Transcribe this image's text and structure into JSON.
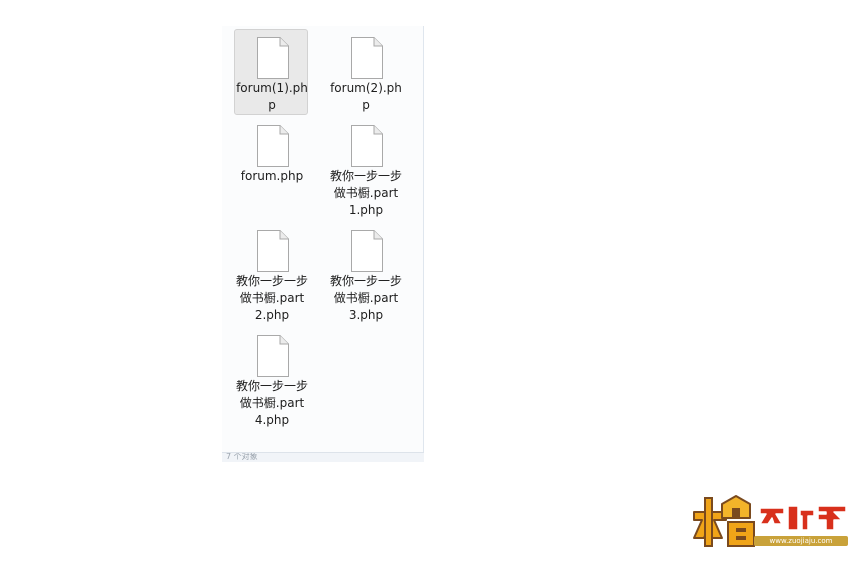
{
  "files": [
    {
      "name": "forum(1).php",
      "selected": true
    },
    {
      "name": "forum(2).php",
      "selected": false
    },
    {
      "name": "forum.php",
      "selected": false
    },
    {
      "name": "教你一步一步做书橱.part1.php",
      "selected": false
    },
    {
      "name": "教你一步一步做书橱.part2.php",
      "selected": false
    },
    {
      "name": "教你一步一步做书橱.part3.php",
      "selected": false
    },
    {
      "name": "教你一步一步做书橱.part4.php",
      "selected": false
    }
  ],
  "file_icon": "document-icon",
  "status_bar": {
    "text": "7 个对象"
  },
  "watermark": {
    "logo_text": "木工爱好者",
    "url": "www.zuojiaju.com",
    "colors": {
      "orange": "#f0a418",
      "brown": "#7a4a1e",
      "red": "#d8301c"
    }
  },
  "colors": {
    "selection_bg": "#e9e9e9",
    "pane_bg": "#fbfcfd",
    "label_text": "#1e1e1e"
  }
}
